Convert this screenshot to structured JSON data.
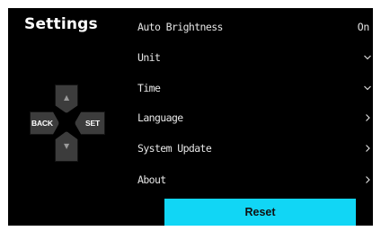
{
  "title": "Settings",
  "dpad": {
    "back_label": "BACK",
    "set_label": "SET",
    "up_glyph": "▲",
    "down_glyph": "▼",
    "up_icon": "chevron-up-icon",
    "down_icon": "chevron-down-icon"
  },
  "menu": {
    "items": [
      {
        "label": "Auto Brightness",
        "value": "On"
      },
      {
        "label": "Unit",
        "icon": "chevron-down-icon"
      },
      {
        "label": "Time",
        "icon": "chevron-down-icon"
      },
      {
        "label": "Language",
        "icon": "chevron-right-icon"
      },
      {
        "label": "System Update",
        "icon": "chevron-right-icon"
      },
      {
        "label": "About",
        "icon": "chevron-right-icon"
      }
    ]
  },
  "reset_label": "Reset",
  "colors": {
    "background": "#000000",
    "accent": "#11d6f5",
    "text": "#e6e6e6",
    "dpad": "#3c3c3c"
  }
}
